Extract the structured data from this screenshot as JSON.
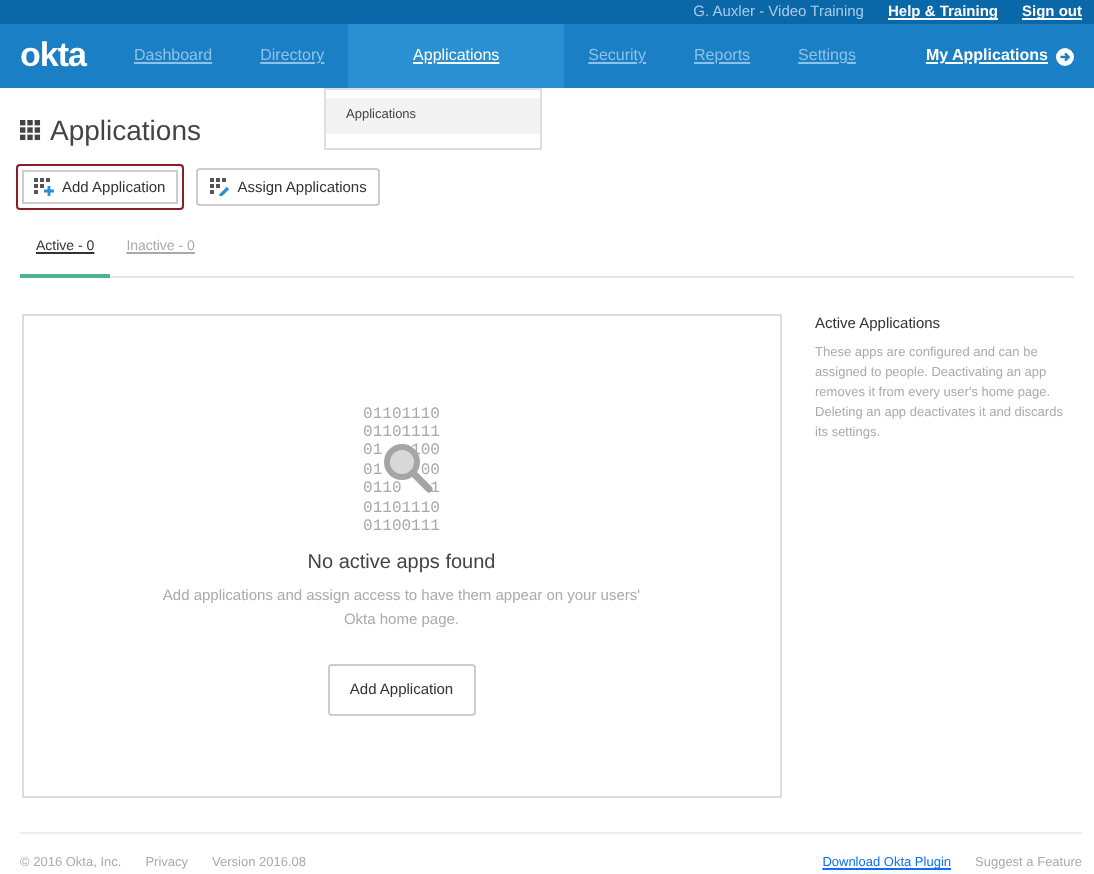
{
  "top_bar": {
    "user": "G. Auxler - Video Training",
    "links": [
      "Help & Training",
      "Sign out"
    ]
  },
  "navbar": {
    "logo": "okta",
    "items": [
      {
        "label": "Dashboard",
        "selected": false
      },
      {
        "label": "Directory",
        "selected": false
      },
      {
        "label": "Applications",
        "selected": true
      },
      {
        "label": "Security",
        "selected": false
      },
      {
        "label": "Reports",
        "selected": false
      },
      {
        "label": "Settings",
        "selected": false
      }
    ],
    "my_apps": "My Applications"
  },
  "dropdown": {
    "items": [
      "Applications"
    ]
  },
  "page_title": "Applications",
  "buttons": [
    {
      "label": "Add Application",
      "highlighted": true
    },
    {
      "label": "Assign Applications",
      "highlighted": false
    }
  ],
  "tabs": [
    {
      "label": "Active - 0",
      "selected": true
    },
    {
      "label": "Inactive - 0",
      "selected": false
    }
  ],
  "empty_state": {
    "binary": [
      [
        "01101110"
      ],
      [
        "01101111"
      ],
      [
        "01",
        "100"
      ],
      [
        "01",
        "00"
      ],
      [
        "0110",
        "1"
      ],
      [
        "01101110"
      ],
      [
        "01100111"
      ]
    ],
    "title": "No active apps found",
    "text": "Add applications and assign access to have them appear on your users' Okta home page.",
    "button": "Add Application"
  },
  "help": {
    "title": "Active Applications",
    "text": "These apps are configured and can be assigned to people. Deactivating an app removes it from every user's home page. Deleting an app deactivates it and discards its settings."
  },
  "footer": {
    "left": [
      "© 2016 Okta, Inc.",
      "Privacy",
      "Version 2016.08"
    ],
    "right": [
      "Download Okta Plugin",
      "Suggest a Feature"
    ]
  }
}
